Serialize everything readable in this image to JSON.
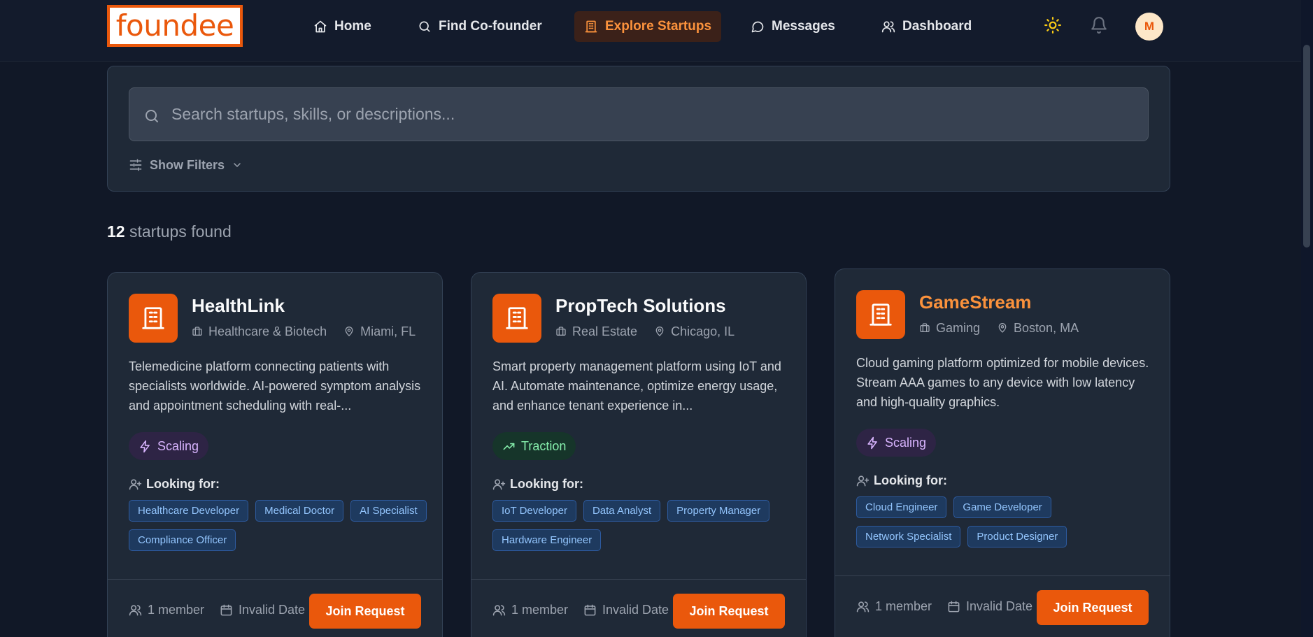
{
  "brand": {
    "logo_text": "foundee",
    "accent": "#ea580c"
  },
  "nav": {
    "items": [
      {
        "label": "Home",
        "icon": "home-icon"
      },
      {
        "label": "Find Co-founder",
        "icon": "search-icon"
      },
      {
        "label": "Explore Startups",
        "icon": "building-icon",
        "active": true
      },
      {
        "label": "Messages",
        "icon": "message-icon"
      },
      {
        "label": "Dashboard",
        "icon": "users-icon"
      }
    ],
    "avatar_initial": "M"
  },
  "search": {
    "placeholder": "Search startups, skills, or descriptions...",
    "value": "",
    "filters_label": "Show Filters"
  },
  "results": {
    "count": "12",
    "label": "startups found"
  },
  "startups": [
    {
      "name": "HealthLink",
      "industry": "Healthcare & Biotech",
      "location": "Miami, FL",
      "description": "Telemedicine platform connecting patients with specialists worldwide. AI-powered symptom analysis and appointment scheduling with real-...",
      "stage": "Scaling",
      "looking_label": "Looking for:",
      "roles": [
        "Healthcare Developer",
        "Medical Doctor",
        "AI Specialist",
        "Compliance Officer"
      ],
      "members": "1 member",
      "date": "Invalid Date",
      "cta": "Join Request"
    },
    {
      "name": "PropTech Solutions",
      "industry": "Real Estate",
      "location": "Chicago, IL",
      "description": "Smart property management platform using IoT and AI. Automate maintenance, optimize energy usage, and enhance tenant experience in...",
      "stage": "Traction",
      "looking_label": "Looking for:",
      "roles": [
        "IoT Developer",
        "Data Analyst",
        "Property Manager",
        "Hardware Engineer"
      ],
      "members": "1 member",
      "date": "Invalid Date",
      "cta": "Join Request"
    },
    {
      "name": "GameStream",
      "industry": "Gaming",
      "location": "Boston, MA",
      "description": "Cloud gaming platform optimized for mobile devices. Stream AAA games to any device with low latency and high-quality graphics.",
      "stage": "Scaling",
      "looking_label": "Looking for:",
      "roles": [
        "Cloud Engineer",
        "Game Developer",
        "Network Specialist",
        "Product Designer"
      ],
      "members": "1 member",
      "date": "Invalid Date",
      "cta": "Join Request"
    }
  ]
}
